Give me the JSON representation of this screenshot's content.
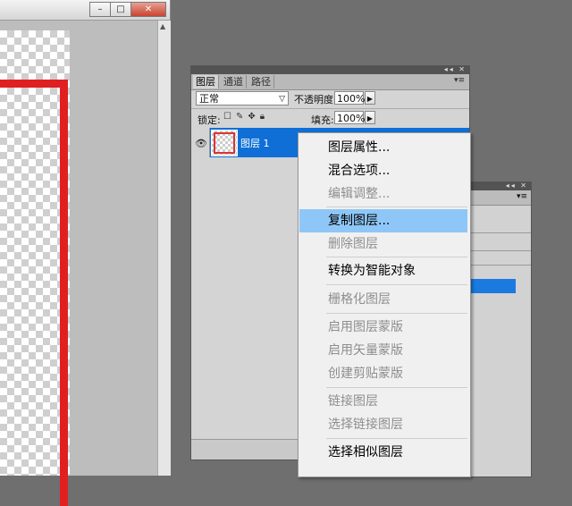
{
  "document_window": {
    "buttons": [
      "–",
      "□",
      "✕"
    ]
  },
  "layers_panel": {
    "tabs": [
      "图层",
      "通道",
      "路径"
    ],
    "blend_mode": "正常",
    "opacity_label": "不透明度:",
    "opacity_value": "100%",
    "lock_label": "锁定:",
    "fill_label": "填充:",
    "fill_value": "100%",
    "layer": {
      "name": "图层 1"
    }
  },
  "context_menu": {
    "items": [
      {
        "label": "图层属性...",
        "enabled": true
      },
      {
        "label": "混合选项...",
        "enabled": true
      },
      {
        "label": "编辑调整...",
        "enabled": false
      },
      {
        "label": "复制图层...",
        "enabled": true,
        "highlighted": true
      },
      {
        "label": "删除图层",
        "enabled": false
      },
      {
        "label": "转换为智能对象",
        "enabled": true
      },
      {
        "label": "栅格化图层",
        "enabled": false
      },
      {
        "label": "启用图层蒙版",
        "enabled": false
      },
      {
        "label": "启用矢量蒙版",
        "enabled": false
      },
      {
        "label": "创建剪贴蒙版",
        "enabled": false
      },
      {
        "label": "链接图层",
        "enabled": false
      },
      {
        "label": "选择链接图层",
        "enabled": false
      },
      {
        "label": "选择相似图层",
        "enabled": true
      }
    ]
  },
  "colors": {
    "selection": "#0f6fd6",
    "menu_highlight": "#8ec7f7",
    "frame_red": "#e02020"
  }
}
